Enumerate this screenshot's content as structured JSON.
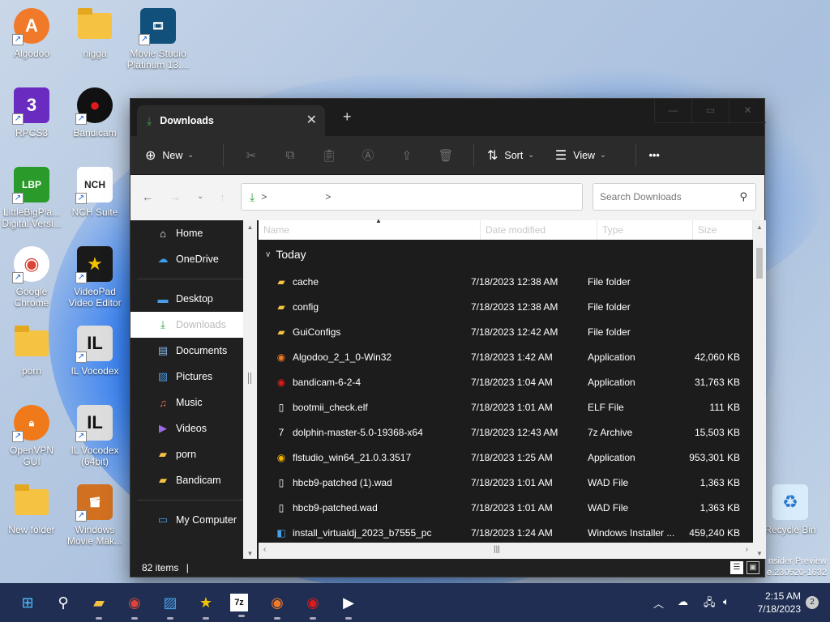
{
  "desktop_icons": [
    {
      "label": "Algodoo",
      "icon": "algodoo-icon",
      "color": "#f07a2a"
    },
    {
      "label": "nigga",
      "icon": "folder-icon",
      "color": "#f5c242"
    },
    {
      "label": "Movie Studio Platinum 13....",
      "icon": "movie-studio-icon",
      "color": "#1a6a9a"
    },
    {
      "label": "RPCS3",
      "icon": "rpcs3-icon",
      "color": "#6a2cc0"
    },
    {
      "label": "Bandicam",
      "icon": "bandicam-icon",
      "color": "#e01a1a"
    },
    {
      "label": "LittleBigPla... Digital Versi...",
      "icon": "littlebigplanet-icon",
      "color": "#2a9a2a"
    },
    {
      "label": "NCH Suite",
      "icon": "nch-suite-icon",
      "color": "#2b2b2b"
    },
    {
      "label": "Google Chrome",
      "icon": "chrome-icon",
      "color": "#db4437"
    },
    {
      "label": "VideoPad Video Editor",
      "icon": "videopad-icon",
      "color": "#f2c200"
    },
    {
      "label": "porn",
      "icon": "folder-icon",
      "color": "#f5c242"
    },
    {
      "label": "IL Vocodex",
      "icon": "il-vocodex-icon",
      "color": "#eeeeee"
    },
    {
      "label": "OpenVPN GUI",
      "icon": "openvpn-icon",
      "color": "#f07a1a"
    },
    {
      "label": "IL Vocodex (64bit)",
      "icon": "il-vocodex-icon",
      "color": "#eeeeee"
    },
    {
      "label": "New folder",
      "icon": "folder-icon",
      "color": "#f5c242"
    },
    {
      "label": "Windows Movie Mak...",
      "icon": "movie-maker-icon",
      "color": "#d07020"
    },
    {
      "label": "Recycle Bin",
      "icon": "recycle-bin-icon",
      "color": "#9ec4e8"
    }
  ],
  "window": {
    "tab_title": "Downloads",
    "toolbar": {
      "new_label": "New",
      "sort_label": "Sort",
      "view_label": "View",
      "more_label": "•••"
    },
    "address_separator": ">",
    "search_placeholder": "Search Downloads",
    "columns": {
      "name": "Name",
      "date": "Date modified",
      "type": "Type",
      "size": "Size"
    },
    "group_label": "Today",
    "status_items": "82 items",
    "sidebar": [
      {
        "label": "Home",
        "icon": "home-icon",
        "pinned": false
      },
      {
        "label": "OneDrive",
        "icon": "onedrive-icon",
        "pinned": false
      },
      {
        "label": "Desktop",
        "icon": "desktop-icon",
        "pinned": true
      },
      {
        "label": "Downloads",
        "icon": "download-icon",
        "pinned": true
      },
      {
        "label": "Documents",
        "icon": "documents-icon",
        "pinned": true
      },
      {
        "label": "Pictures",
        "icon": "pictures-icon",
        "pinned": true
      },
      {
        "label": "Music",
        "icon": "music-icon",
        "pinned": true
      },
      {
        "label": "Videos",
        "icon": "videos-icon",
        "pinned": true
      },
      {
        "label": "porn",
        "icon": "folder-icon",
        "pinned": true
      },
      {
        "label": "Bandicam",
        "icon": "folder-icon",
        "pinned": false
      },
      {
        "label": "My Computer",
        "icon": "computer-icon",
        "pinned": false
      }
    ],
    "files": [
      {
        "name": "cache",
        "date": "7/18/2023 12:38 AM",
        "type": "File folder",
        "size": "",
        "icon": "folder-icon"
      },
      {
        "name": "config",
        "date": "7/18/2023 12:38 AM",
        "type": "File folder",
        "size": "",
        "icon": "folder-icon"
      },
      {
        "name": "GuiConfigs",
        "date": "7/18/2023 12:42 AM",
        "type": "File folder",
        "size": "",
        "icon": "folder-icon"
      },
      {
        "name": "Algodoo_2_1_0-Win32",
        "date": "7/18/2023 1:42 AM",
        "type": "Application",
        "size": "42,060 KB",
        "icon": "algodoo-icon"
      },
      {
        "name": "bandicam-6-2-4",
        "date": "7/18/2023 1:04 AM",
        "type": "Application",
        "size": "31,763 KB",
        "icon": "bandicam-icon"
      },
      {
        "name": "bootmii_check.elf",
        "date": "7/18/2023 1:01 AM",
        "type": "ELF File",
        "size": "111 KB",
        "icon": "file-icon"
      },
      {
        "name": "dolphin-master-5.0-19368-x64",
        "date": "7/18/2023 12:43 AM",
        "type": "7z Archive",
        "size": "15,503 KB",
        "icon": "7z-icon"
      },
      {
        "name": "flstudio_win64_21.0.3.3517",
        "date": "7/18/2023 1:25 AM",
        "type": "Application",
        "size": "953,301 KB",
        "icon": "flstudio-icon"
      },
      {
        "name": "hbcb9-patched (1).wad",
        "date": "7/18/2023 1:01 AM",
        "type": "WAD File",
        "size": "1,363 KB",
        "icon": "file-icon"
      },
      {
        "name": "hbcb9-patched.wad",
        "date": "7/18/2023 1:01 AM",
        "type": "WAD File",
        "size": "1,363 KB",
        "icon": "file-icon"
      },
      {
        "name": "install_virtualdj_2023_b7555_pc",
        "date": "7/18/2023 1:24 AM",
        "type": "Windows Installer ...",
        "size": "459,240 KB",
        "icon": "installer-icon"
      }
    ]
  },
  "watermark": {
    "line1": "nsider Preview",
    "line2": "e.230520-1632"
  },
  "taskbar": {
    "time": "2:15 AM",
    "date": "7/18/2023",
    "notification_count": "2",
    "apps": [
      "start-icon",
      "search-icon",
      "file-explorer-icon",
      "chrome-icon",
      "photos-icon",
      "videopad-icon",
      "7zip-icon",
      "algodoo-icon",
      "bandicam-icon",
      "media-player-icon"
    ]
  },
  "colors": {
    "taskbar": "#1f2e52",
    "accent_download": "#2ea043",
    "window_dark": "#202020"
  }
}
